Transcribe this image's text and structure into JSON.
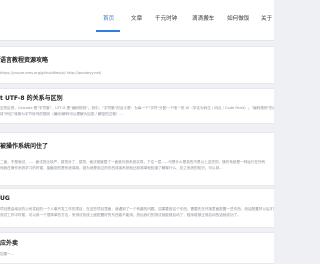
{
  "nav": {
    "items": [
      {
        "label": "首页",
        "active": true
      },
      {
        "label": "文章",
        "active": false
      },
      {
        "label": "千元时钟",
        "active": false
      },
      {
        "label": "滴滴搬车",
        "active": false
      },
      {
        "label": "如何做饭",
        "active": false
      },
      {
        "label": "关于",
        "active": false
      }
    ]
  },
  "posts": [
    {
      "title": "语言教程资源攻略",
      "lines": [
        "https://yuque-ems.org/githubfiles/ai/ http://ipnoteyy.net/"
      ]
    },
    {
      "title": "t UTF-8 的关系与区别",
      "lines": [
        "空的区别，Unicode 是\"字符集\"，UTF-8 是\"编码规则\"。其中，\"字符集\"的含义是：为每一个\"字符\"分配一个唯一的 ID（学名为码位 / 码点 / Code Point）；\"编码规则\"的含义",
        "将\"码位\"转换为字节序列的规则（编码/解码可以理解为加密 / 解密的过程）..."
      ]
    },
    {
      "title": "被操作系统问住了",
      "lines": [
        "二面，不是面试，......面试官比较严，感觉对了，感觉，面试难度整了一面被问到系统实现，下往一层......可是什么是真的不是以上这些的，操作系统是一种运行在所有",
        "而我在操作系统学习的时候，接触到的是系统调用，因为我是用过的东西或者系统就比较简单就知道了解释什么，总之系统的知识，可以到..."
      ]
    },
    {
      "title": "UG",
      "lines": [
        "项目是由南京的公司发起的一个人事开发工作的项目，在这些项目里面，我遇到了一个有趣的问题，如果要用这个东西，需要先在环境里面配置一些东西，然后配置好以后才能运行起来的项目",
        "测试工作中时候，可以用一个很简单的方法，来测试系统上面配置好的东西能不能用，然后我们的测试就能够启动了，程序能够正常启动的话就成功了。"
      ]
    },
    {
      "title": "应外卖",
      "lines": [
        "如果一..."
      ]
    }
  ]
}
